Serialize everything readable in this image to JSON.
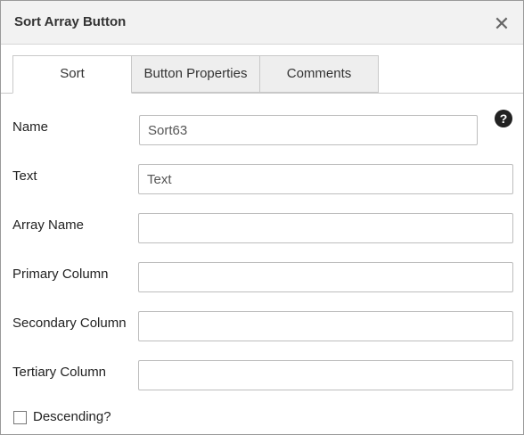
{
  "dialog": {
    "title": "Sort Array Button",
    "close_icon": "close-icon",
    "help_icon": "help-icon",
    "help_symbol": "?"
  },
  "tabs": [
    {
      "label": "Sort",
      "active": true
    },
    {
      "label": "Button Properties",
      "active": false
    },
    {
      "label": "Comments",
      "active": false
    }
  ],
  "fields": {
    "name": {
      "label": "Name",
      "value": "Sort63"
    },
    "text": {
      "label": "Text",
      "value": "Text"
    },
    "array_name": {
      "label": "Array Name",
      "value": ""
    },
    "primary_column": {
      "label": "Primary Column",
      "value": ""
    },
    "secondary_column": {
      "label": "Secondary Column",
      "value": ""
    },
    "tertiary_column": {
      "label": "Tertiary Column",
      "value": ""
    }
  },
  "descending": {
    "label": "Descending?",
    "checked": false
  }
}
